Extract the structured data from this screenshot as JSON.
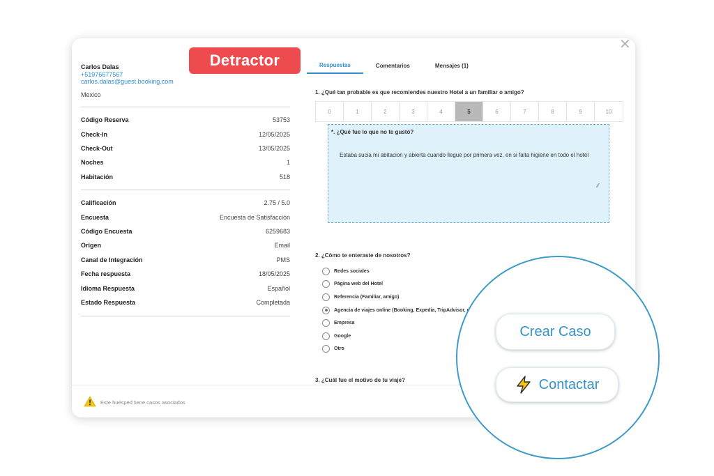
{
  "guest": {
    "name": "Carlos Dalas",
    "phone": "+51976677567",
    "email": "carlos.dalas@guest.booking.com",
    "country": "Mexico"
  },
  "badge": "Detractor",
  "reservation": [
    {
      "label": "Código Reserva",
      "value": "53753"
    },
    {
      "label": "Check-In",
      "value": "12/05/2025"
    },
    {
      "label": "Check-Out",
      "value": "13/05/2025"
    },
    {
      "label": "Noches",
      "value": "1"
    },
    {
      "label": "Habitación",
      "value": "518"
    }
  ],
  "survey": [
    {
      "label": "Calificación",
      "value": "2.75 / 5.0"
    },
    {
      "label": "Encuesta",
      "value": "Encuesta de Satisfacción"
    },
    {
      "label": "Código Encuesta",
      "value": "6259683"
    },
    {
      "label": "Origen",
      "value": "Email"
    },
    {
      "label": "Canal de Integración",
      "value": "PMS"
    },
    {
      "label": "Fecha respuesta",
      "value": "18/05/2025"
    },
    {
      "label": "Idioma Respuesta",
      "value": "Español"
    },
    {
      "label": "Estado Respuesta",
      "value": "Completada"
    }
  ],
  "tabs": [
    {
      "label": "Respuestas",
      "active": true
    },
    {
      "label": "Comentarios",
      "active": false
    },
    {
      "label": "Mensajes (1)",
      "active": false
    }
  ],
  "q1": {
    "text": "1. ¿Qué tan probable es que recomiendes nuestro Hotel a un familiar o amigo?",
    "scale": [
      "0",
      "1",
      "2",
      "3",
      "4",
      "5",
      "6",
      "7",
      "8",
      "9",
      "10"
    ],
    "selected": "5",
    "followup_label": "*. ¿Qué fue lo que no te gustó?",
    "followup_answer": "Estaba sucia mi abitacion y abierta cuando llegue por primera vez, en si falta higiene en todo el hotel"
  },
  "q2": {
    "text": "2. ¿Cómo te enteraste de nosotros?",
    "options": [
      {
        "label": "Redes sociales",
        "selected": false
      },
      {
        "label": "Página web del Hotel",
        "selected": false
      },
      {
        "label": "Referencia (Familiar, amigo)",
        "selected": false
      },
      {
        "label": "Agencia de viajes online (Booking, Expedia, TripAdvisor, etc",
        "selected": true
      },
      {
        "label": "Empresa",
        "selected": false
      },
      {
        "label": "Google",
        "selected": false
      },
      {
        "label": "Otro",
        "selected": false
      }
    ]
  },
  "q3": {
    "text": "3. ¿Cuál fue el motivo de tu viaje?"
  },
  "footer": {
    "text": "Este huésped tiene casos asociados"
  },
  "actions": {
    "crear_caso": "Crear Caso",
    "contactar": "Contactar"
  },
  "icons": {
    "close": "close-icon",
    "warning": "warning-icon",
    "bolt": "lightning-bolt-icon"
  },
  "colors": {
    "accent": "#2d8fd5",
    "detractor": "#ee4b4f",
    "answer_bg": "#dff1fb",
    "warning": "#f5c518",
    "bolt": "#f5c518"
  }
}
